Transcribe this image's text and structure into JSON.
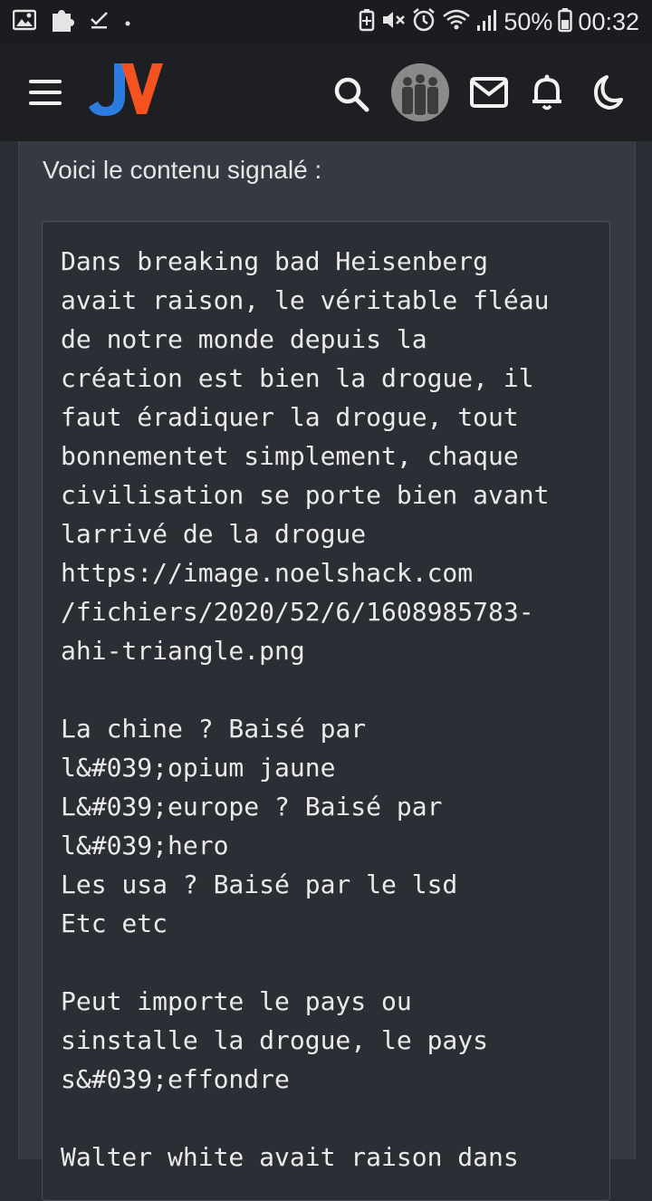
{
  "status_bar": {
    "battery": "50%",
    "time": "00:32"
  },
  "header": {
    "logo_text": "JV",
    "icons": [
      "menu-icon",
      "search-icon",
      "avatar",
      "mail-icon",
      "bell-icon",
      "moon-icon"
    ]
  },
  "content": {
    "intro": "Voici le contenu signalé :",
    "lines": [
      "Dans breaking bad Heisenberg",
      "avait raison, le véritable fléau",
      "de notre monde depuis la",
      "création est bien la drogue, il",
      "faut éradiquer la drogue, tout",
      "bonnementet simplement, chaque",
      "civilisation se porte bien avant",
      "larrivé de la drogue",
      "https://image.noelshack.com",
      "/fichiers/2020/52/6/1608985783-",
      "ahi-triangle.png",
      "",
      "La chine ? Baisé par",
      "l&#039;opium jaune",
      "L&#039;europe ? Baisé par",
      "l&#039;hero",
      "Les usa ? Baisé par le lsd",
      "Etc etc",
      "",
      "Peut importe le pays ou",
      "sinstalle la drogue, le pays",
      "s&#039;effondre",
      "",
      "Walter white avait raison dans"
    ]
  },
  "colors": {
    "header_bg": "#1e1f22",
    "page_bg": "#353a42",
    "quote_bg": "#2b2e34",
    "logo_blue": "#2b7be0",
    "logo_orange": "#f5521f"
  }
}
